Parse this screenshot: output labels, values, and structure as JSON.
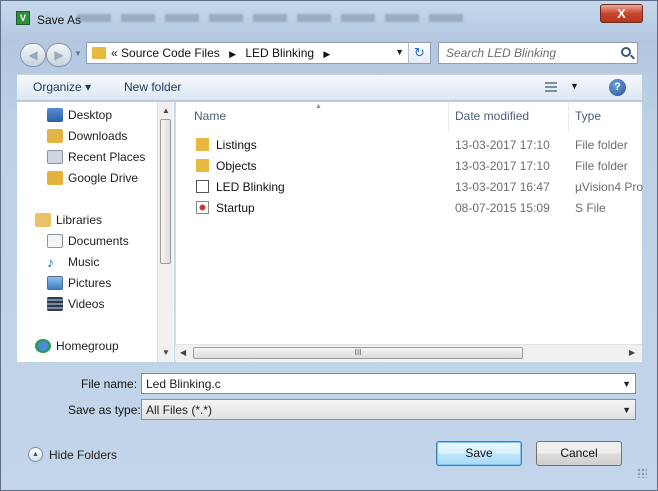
{
  "window": {
    "title": "Save As",
    "app_icon_glyph": "V",
    "close_label": "X"
  },
  "address": {
    "prefix": "«",
    "crumbs": [
      "Source Code Files",
      "LED Blinking"
    ],
    "search_placeholder": "Search LED Blinking"
  },
  "toolbar": {
    "organize_label": "Organize ▾",
    "new_folder_label": "New folder",
    "help_label": "?"
  },
  "nav": {
    "items": [
      {
        "label": "Desktop",
        "icon": "desktop-icon"
      },
      {
        "label": "Downloads",
        "icon": "downloads-icon"
      },
      {
        "label": "Recent Places",
        "icon": "recent-places-icon"
      },
      {
        "label": "Google Drive",
        "icon": "google-drive-icon"
      },
      {
        "label": "Libraries",
        "icon": "libraries-icon"
      },
      {
        "label": "Documents",
        "icon": "documents-icon"
      },
      {
        "label": "Music",
        "icon": "music-icon"
      },
      {
        "label": "Pictures",
        "icon": "pictures-icon"
      },
      {
        "label": "Videos",
        "icon": "videos-icon"
      },
      {
        "label": "Homegroup",
        "icon": "homegroup-icon"
      }
    ]
  },
  "list": {
    "columns": [
      "Name",
      "Date modified",
      "Type"
    ],
    "rows": [
      {
        "name": "Listings",
        "date": "13-03-2017 17:10",
        "type": "File folder",
        "icon": "folder-icon"
      },
      {
        "name": "Objects",
        "date": "13-03-2017 17:10",
        "type": "File folder",
        "icon": "folder-icon"
      },
      {
        "name": "LED Blinking",
        "date": "13-03-2017 16:47",
        "type": "µVision4 Pro",
        "icon": "uvision-project-icon"
      },
      {
        "name": "Startup",
        "date": "08-07-2015 15:09",
        "type": "S File",
        "icon": "s-file-icon"
      }
    ],
    "hscroll_grip": "III"
  },
  "form": {
    "file_name_label": "File name:",
    "file_name_value": "Led Blinking.c",
    "save_type_label": "Save as type:",
    "save_type_value": "All Files (*.*)"
  },
  "footer": {
    "hide_folders_label": "Hide Folders",
    "save_label": "Save",
    "cancel_label": "Cancel"
  },
  "colors": {
    "frame": "#b9c9dd",
    "folder": "#e8b840",
    "default_button": "#bee6fd"
  }
}
